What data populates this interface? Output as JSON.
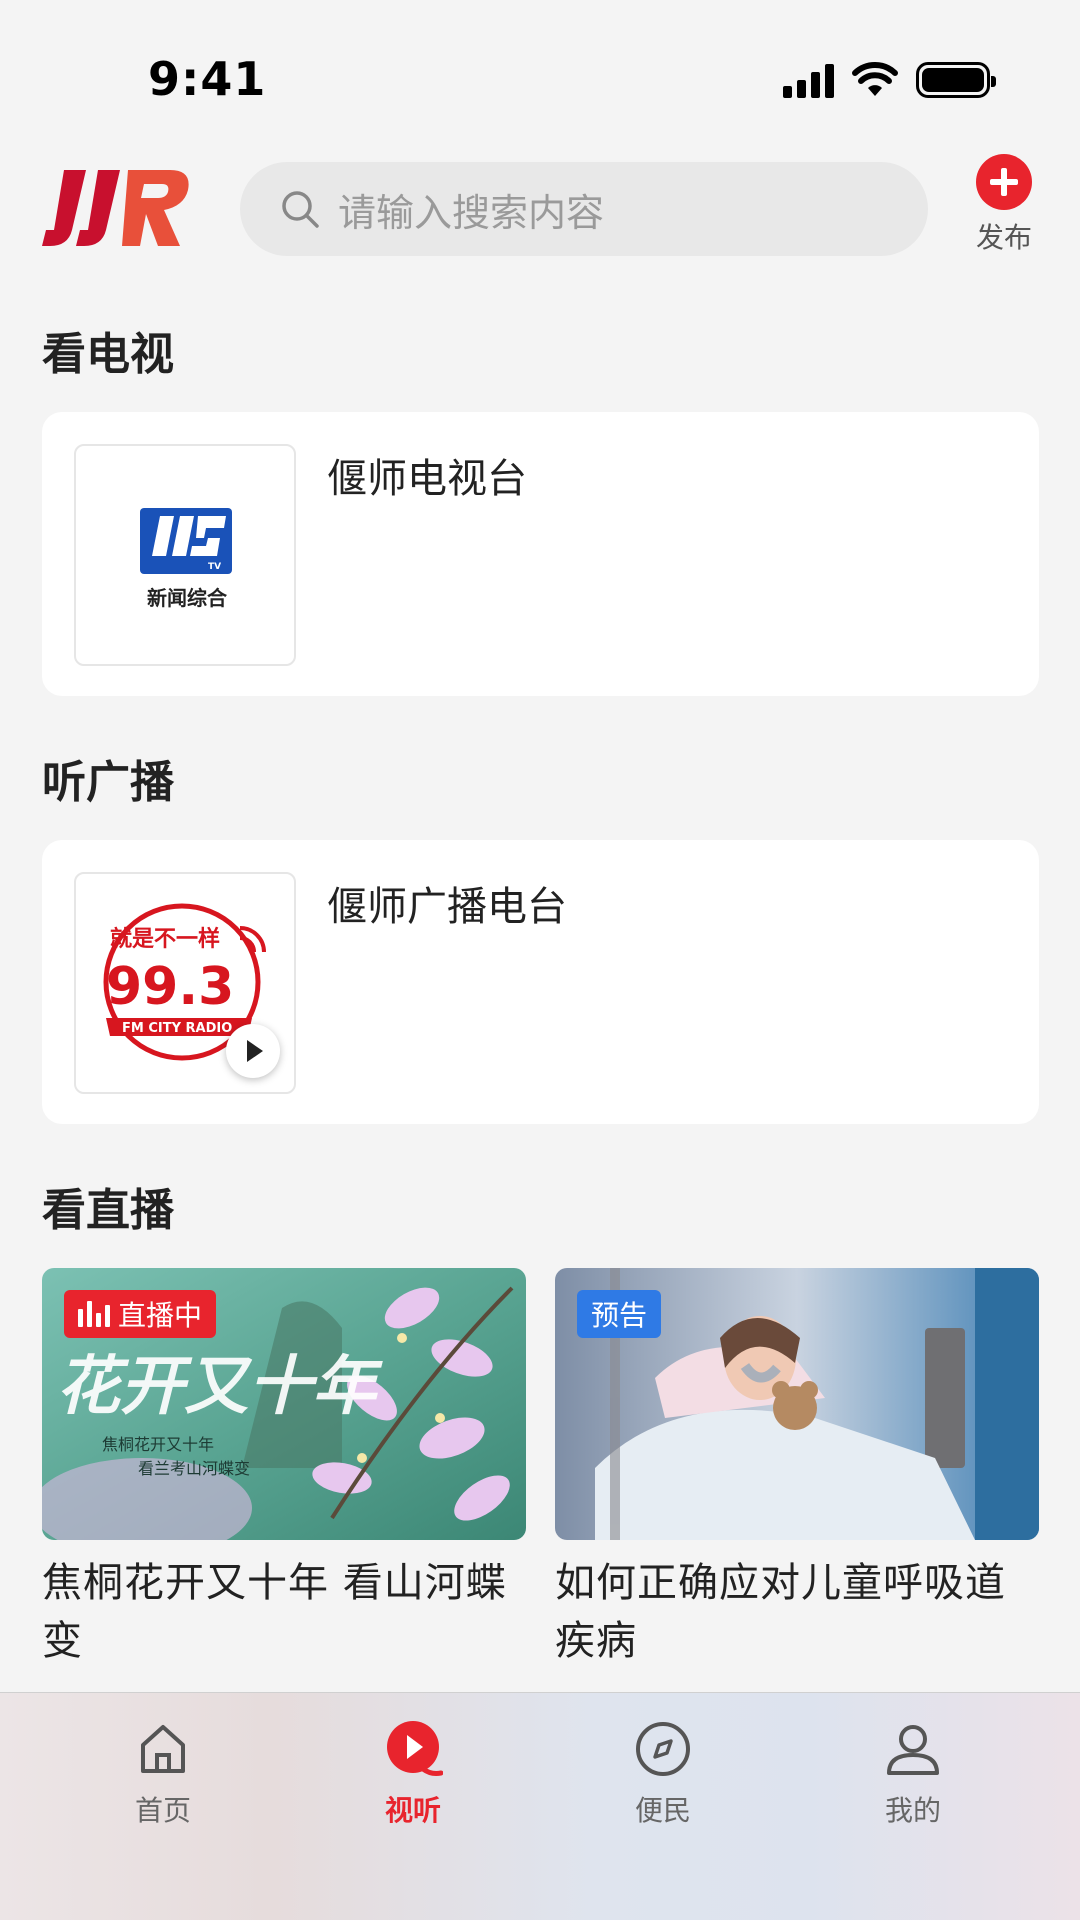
{
  "status_bar": {
    "time": "9:41"
  },
  "header": {
    "search_placeholder": "请输入搜索内容",
    "publish_label": "发布"
  },
  "sections": {
    "tv": {
      "title": "看电视",
      "channel_name": "偃师电视台",
      "logo_text": "新闻综合"
    },
    "radio": {
      "title": "听广播",
      "station_name": "偃师广播电台",
      "logo_slogan": "就是不一样",
      "logo_freq": "99.3",
      "logo_band": "FM CITY RADIO"
    },
    "live": {
      "title": "看直播",
      "items": [
        {
          "badge": "直播中",
          "title": "焦桐花开又十年 看山河蝶变",
          "image_caption_1": "焦桐花开又十年",
          "image_caption_2": "看兰考山河蝶变"
        },
        {
          "badge": "预告",
          "title": "如何正确应对儿童呼吸道疾病"
        }
      ]
    }
  },
  "tab_bar": {
    "items": [
      {
        "label": "首页",
        "icon": "home-icon"
      },
      {
        "label": "视听",
        "icon": "play-icon"
      },
      {
        "label": "便民",
        "icon": "compass-icon"
      },
      {
        "label": "我的",
        "icon": "user-icon"
      }
    ],
    "active": "视听"
  },
  "colors": {
    "accent": "#e8242d",
    "preview_badge": "#2f7ae5",
    "background": "#f4f4f4"
  }
}
